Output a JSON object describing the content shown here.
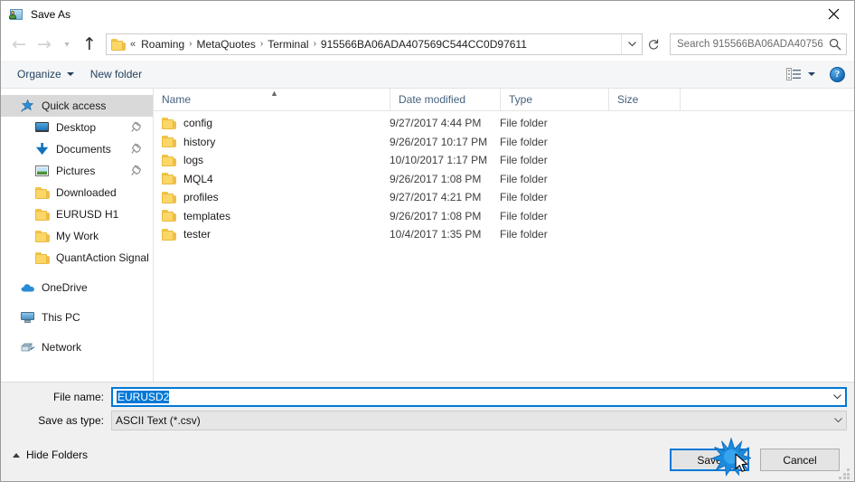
{
  "window": {
    "title": "Save As",
    "title_icon": "picture-person-icon",
    "close_label": "✕"
  },
  "nav": {
    "back_icon": "arrow-left-icon",
    "forward_icon": "arrow-right-icon",
    "recent_icon": "chevron-down-icon",
    "up_icon": "arrow-up-icon",
    "breadcrumb_prefix": "«",
    "breadcrumbs": [
      "Roaming",
      "MetaQuotes",
      "Terminal",
      "915566BA06ADA407569C544CC0D97611"
    ],
    "separator": "›",
    "dropdown_icon": "chevron-down-icon",
    "refresh_icon": "refresh-icon"
  },
  "search": {
    "placeholder": "Search 915566BA06ADA40756...",
    "icon": "search-icon"
  },
  "toolbar": {
    "organize_label": "Organize",
    "new_folder_label": "New folder",
    "view_icon": "view-list-icon",
    "view_caret_icon": "chevron-down-icon",
    "help_label": "?",
    "help_icon": "help-icon"
  },
  "sidebar": {
    "items": [
      {
        "label": "Quick access",
        "icon": "star-pin-icon",
        "selected": true,
        "indent": 0,
        "pinned": false,
        "group": false
      },
      {
        "label": "Desktop",
        "icon": "desktop-icon",
        "selected": false,
        "indent": 1,
        "pinned": true,
        "group": false
      },
      {
        "label": "Documents",
        "icon": "documents-icon",
        "selected": false,
        "indent": 1,
        "pinned": true,
        "group": false
      },
      {
        "label": "Pictures",
        "icon": "pictures-icon",
        "selected": false,
        "indent": 1,
        "pinned": true,
        "group": false
      },
      {
        "label": "Downloaded",
        "icon": "folder-icon",
        "selected": false,
        "indent": 1,
        "pinned": false,
        "group": false
      },
      {
        "label": "EURUSD H1",
        "icon": "folder-icon",
        "selected": false,
        "indent": 1,
        "pinned": false,
        "group": false
      },
      {
        "label": "My Work",
        "icon": "folder-icon",
        "selected": false,
        "indent": 1,
        "pinned": false,
        "group": false
      },
      {
        "label": "QuantAction Signal",
        "icon": "folder-icon",
        "selected": false,
        "indent": 1,
        "pinned": false,
        "group": false
      },
      {
        "label": "OneDrive",
        "icon": "onedrive-icon",
        "selected": false,
        "indent": 0,
        "pinned": false,
        "group": true
      },
      {
        "label": "This PC",
        "icon": "this-pc-icon",
        "selected": false,
        "indent": 0,
        "pinned": false,
        "group": true
      },
      {
        "label": "Network",
        "icon": "network-icon",
        "selected": false,
        "indent": 0,
        "pinned": false,
        "group": true
      }
    ]
  },
  "filelist": {
    "columns": [
      "Name",
      "Date modified",
      "Type",
      "Size"
    ],
    "sort_column": "Name",
    "sort_direction": "asc",
    "rows": [
      {
        "name": "config",
        "date": "9/27/2017 4:44 PM",
        "type": "File folder",
        "size": "",
        "icon": "folder-icon"
      },
      {
        "name": "history",
        "date": "9/26/2017 10:17 PM",
        "type": "File folder",
        "size": "",
        "icon": "folder-icon"
      },
      {
        "name": "logs",
        "date": "10/10/2017 1:17 PM",
        "type": "File folder",
        "size": "",
        "icon": "folder-icon"
      },
      {
        "name": "MQL4",
        "date": "9/26/2017 1:08 PM",
        "type": "File folder",
        "size": "",
        "icon": "folder-icon"
      },
      {
        "name": "profiles",
        "date": "9/27/2017 4:21 PM",
        "type": "File folder",
        "size": "",
        "icon": "folder-icon"
      },
      {
        "name": "templates",
        "date": "9/26/2017 1:08 PM",
        "type": "File folder",
        "size": "",
        "icon": "folder-icon"
      },
      {
        "name": "tester",
        "date": "10/4/2017 1:35 PM",
        "type": "File folder",
        "size": "",
        "icon": "folder-icon"
      }
    ]
  },
  "form": {
    "filename_label": "File name:",
    "filename_value": "EURUSD2",
    "filename_selected": true,
    "savetype_label": "Save as type:",
    "savetype_value": "ASCII Text (*.csv)",
    "dropdown_icon": "chevron-down-icon"
  },
  "footer": {
    "hide_folders_label": "Hide Folders",
    "hide_folders_icon": "chevron-up-icon",
    "save_label": "Save",
    "cancel_label": "Cancel",
    "resize_grip_icon": "resize-grip-icon"
  },
  "pointer": {
    "cursor_icon": "mouse-pointer-icon",
    "click_effect_icon": "click-burst-icon"
  },
  "colors": {
    "accent": "#0078d7",
    "folder_yellow": "#fcd667",
    "header_text": "#44617e",
    "chrome_bg": "#f0f0f0",
    "selection_bg": "#d9d9d9"
  }
}
